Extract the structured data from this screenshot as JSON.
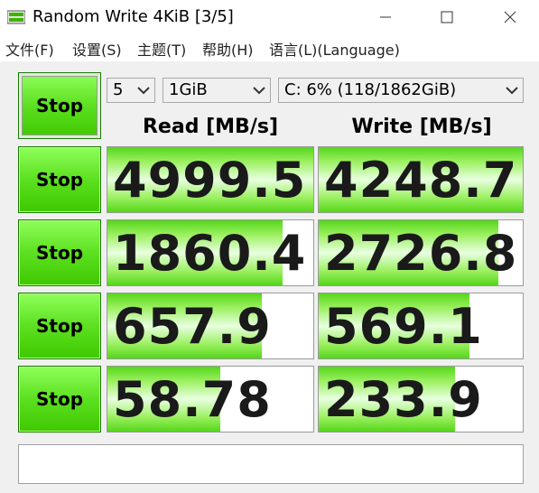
{
  "window": {
    "title": "Random Write 4KiB [3/5]"
  },
  "menu": [
    {
      "label": "文件(F)"
    },
    {
      "label": "设置(S)"
    },
    {
      "label": "主题(T)"
    },
    {
      "label": "帮助(H)"
    },
    {
      "label": "语言(L)(Language)"
    }
  ],
  "controls": {
    "all_button_label": "Stop",
    "count_value": "5",
    "size_value": "1GiB",
    "drive_value": "C: 6% (118/1862GiB)"
  },
  "headers": {
    "read": "Read [MB/s]",
    "write": "Write [MB/s]"
  },
  "rows": [
    {
      "button_label": "Stop",
      "read": "4999.5",
      "write": "4248.7",
      "read_fill": 1.0,
      "write_fill": 1.0
    },
    {
      "button_label": "Stop",
      "read": "1860.4",
      "write": "2726.8",
      "read_fill": 0.85,
      "write_fill": 0.88
    },
    {
      "button_label": "Stop",
      "read": "657.9",
      "write": "569.1",
      "read_fill": 0.75,
      "write_fill": 0.74
    },
    {
      "button_label": "Stop",
      "read": "58.78",
      "write": "233.9",
      "read_fill": 0.55,
      "write_fill": 0.67
    }
  ],
  "status": {
    "text": ""
  },
  "colors": {
    "button_green": "#5ce020",
    "fill_green": "#55d61a"
  }
}
